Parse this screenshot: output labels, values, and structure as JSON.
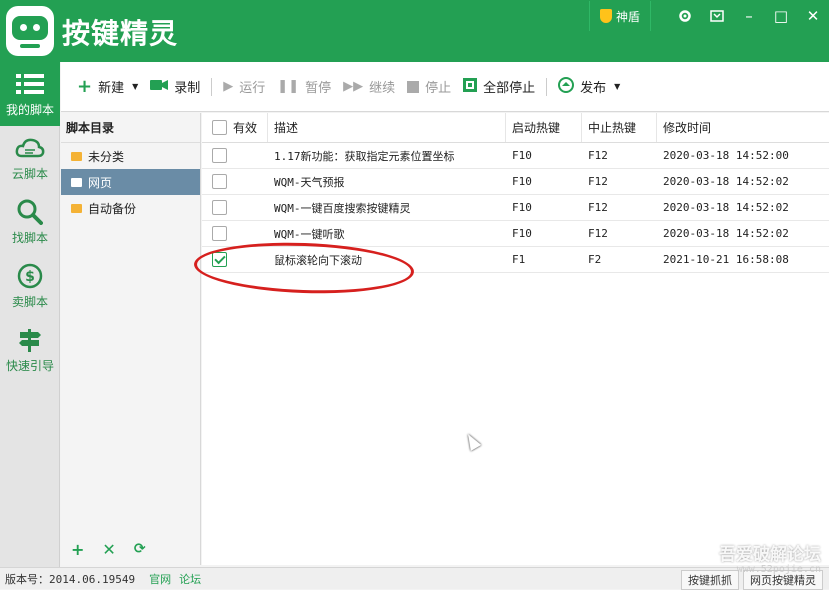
{
  "app": {
    "title": "按键精灵"
  },
  "window": {
    "shield_label": "神盾",
    "settings_icon": "gear-icon",
    "skin_icon": "skin-icon",
    "min": "–",
    "max": "□",
    "close": "✕"
  },
  "nav": [
    {
      "label": "我的脚本",
      "icon": "list-icon",
      "active": true
    },
    {
      "label": "云脚本",
      "icon": "cloud-icon"
    },
    {
      "label": "找脚本",
      "icon": "search-icon"
    },
    {
      "label": "卖脚本",
      "icon": "dollar-icon"
    },
    {
      "label": "快速引导",
      "icon": "signpost-icon"
    }
  ],
  "toolbar": {
    "new": "新建",
    "record": "录制",
    "run": "运行",
    "pause": "暂停",
    "continue": "继续",
    "stop": "停止",
    "stop_all": "全部停止",
    "publish": "发布"
  },
  "dir": {
    "header": "脚本目录",
    "items": [
      "未分类",
      "网页",
      "自动备份"
    ],
    "selected": "网页"
  },
  "table": {
    "headers": {
      "valid": "有效",
      "desc": "描述",
      "start": "启动热键",
      "stop": "中止热键",
      "time": "修改时间"
    },
    "rows": [
      {
        "checked": false,
        "desc": "1.17新功能：获取指定元素位置坐标",
        "start": "F10",
        "stop": "F12",
        "time": "2020-03-18 14:52:00"
      },
      {
        "checked": false,
        "desc": "WQM-天气预报",
        "start": "F10",
        "stop": "F12",
        "time": "2020-03-18 14:52:02"
      },
      {
        "checked": false,
        "desc": "WQM-一键百度搜索按键精灵",
        "start": "F10",
        "stop": "F12",
        "time": "2020-03-18 14:52:02"
      },
      {
        "checked": false,
        "desc": "WQM-一键听歌",
        "start": "F10",
        "stop": "F12",
        "time": "2020-03-18 14:52:02"
      },
      {
        "checked": true,
        "desc": "鼠标滚轮向下滚动",
        "start": "F1",
        "stop": "F2",
        "time": "2021-10-21 16:58:08"
      }
    ]
  },
  "status": {
    "version_label": "版本号：",
    "version": "2014.06.19549",
    "links": [
      "官网",
      "论坛"
    ],
    "tabs": [
      "按键抓抓",
      "网页按键精灵"
    ]
  },
  "watermark": {
    "text": "吾爱破解论坛",
    "url": "www.52pojie.cn"
  },
  "colors": {
    "brand_green": "#23a053",
    "annotation_red": "#d6201e",
    "selected_folder": "#6a8ca6"
  }
}
